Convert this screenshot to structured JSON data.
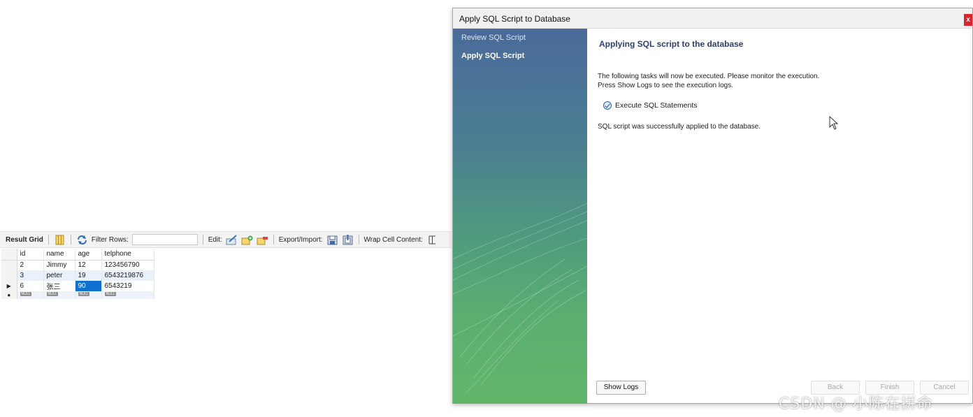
{
  "result_grid": {
    "toolbar": {
      "result_grid_label": "Result Grid",
      "filter_rows_label": "Filter Rows:",
      "filter_value": "",
      "edit_label": "Edit:",
      "export_import_label": "Export/Import:",
      "wrap_cell_label": "Wrap Cell Content:"
    },
    "columns": [
      "id",
      "name",
      "age",
      "telphone"
    ],
    "rows": [
      {
        "id": "2",
        "name": "Jimmy",
        "age": "12",
        "telphone": "123456790"
      },
      {
        "id": "3",
        "name": "peter",
        "age": "19",
        "telphone": "6543219876"
      },
      {
        "id": "6",
        "name": "张三",
        "age": "90",
        "telphone": "6543219"
      }
    ],
    "new_row": {
      "marker": "●",
      "null_text": "NULL"
    },
    "current_row_marker": "▶"
  },
  "dialog": {
    "title": "Apply SQL Script to Database",
    "close_label": "x",
    "steps": [
      "Review SQL Script",
      "Apply SQL Script"
    ],
    "current_step": "Apply SQL Script",
    "heading": "Applying SQL script to the database",
    "description_line1": "The following tasks will now be executed. Please monitor the execution.",
    "description_line2": "Press Show Logs to see the execution logs.",
    "task_label": "Execute SQL Statements",
    "result_message": "SQL script was successfully applied to the database.",
    "buttons": {
      "show_logs": "Show Logs",
      "back": "Back",
      "finish": "Finish",
      "cancel": "Cancel"
    }
  },
  "watermark": "CSDN @ 小陈在拼命",
  "colors": {
    "dialog_heading": "#2c3f72",
    "sidebar_top": "#4a6a9a",
    "sidebar_bottom": "#63b669",
    "selection": "#0e70d1",
    "close_button": "#d7262d"
  }
}
